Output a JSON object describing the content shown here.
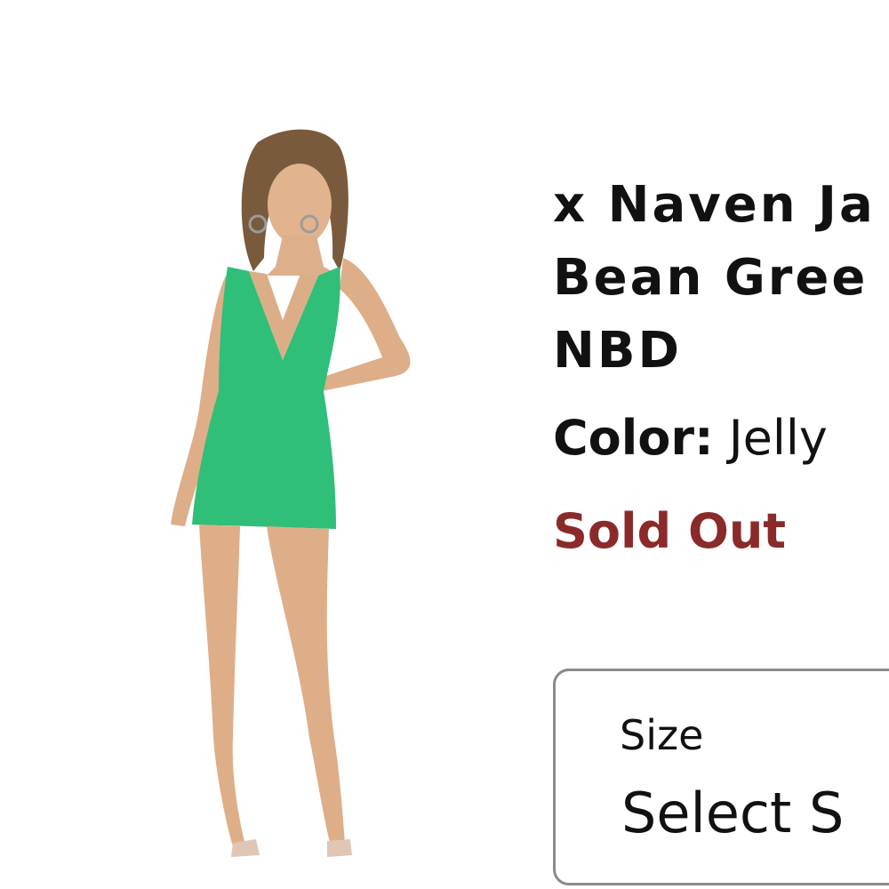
{
  "product": {
    "title_lines": [
      "x Naven Ja",
      "Bean Gree",
      "NBD"
    ],
    "color_label": "Color:",
    "color_value": "Jelly",
    "status": "Sold Out",
    "status_color": "#8b2a2a",
    "dress_color": "#2fbf78"
  },
  "size_selector": {
    "label": "Size",
    "value": "Select S"
  }
}
